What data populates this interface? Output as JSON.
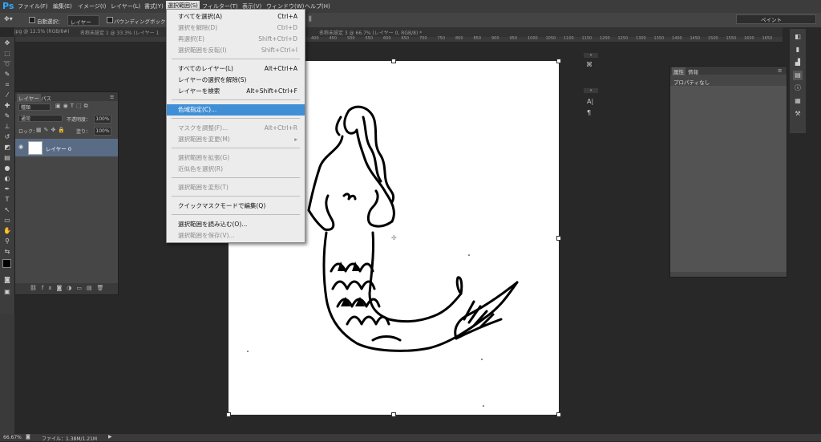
{
  "app": {
    "logo": "Ps"
  },
  "menubar": [
    {
      "label": "ファイル(F)"
    },
    {
      "label": "編集(E)"
    },
    {
      "label": "イメージ(I)"
    },
    {
      "label": "レイヤー(L)"
    },
    {
      "label": "書式(Y)"
    },
    {
      "label": "選択範囲(S)"
    },
    {
      "label": "フィルター(T)"
    },
    {
      "label": "表示(V)"
    },
    {
      "label": "ウィンドウ(W)"
    },
    {
      "label": "ヘルプ(H)"
    }
  ],
  "options": {
    "auto_select_label": "自動選択：",
    "auto_select_value": "レイヤー",
    "bbox_label": "バウンディングボックスを表",
    "workspace": "ペイント"
  },
  "tabs": [
    {
      "label": "jpg @ 12.5% (RGB/8#)"
    },
    {
      "label": "名称未設定 1 @ 33.3% (レイヤー 1"
    },
    {
      "label": "名称未設定 3 @ 66.7% (レイヤー 0, RGB/8) *"
    }
  ],
  "ruler_ticks": [
    "200",
    "250",
    "300",
    "350",
    "400",
    "450",
    "500",
    "550",
    "600",
    "650",
    "700",
    "750",
    "800",
    "850",
    "900",
    "950",
    "1000",
    "1050",
    "1100",
    "1150",
    "1200",
    "1250",
    "1300",
    "1350",
    "1400",
    "1450",
    "1500",
    "1550",
    "1600",
    "1650"
  ],
  "layers_panel": {
    "tab_layers": "レイヤー",
    "tab_paths": "パス",
    "kind_filter": "種類",
    "blend_mode": "通常",
    "opacity_label": "不透明度：",
    "opacity_value": "100%",
    "lock_label": "ロック：",
    "fill_label": "塗り：",
    "fill_value": "100%",
    "layer_name": "レイヤー 0"
  },
  "props_panel": {
    "tab_props": "属性",
    "tab_info": "情報",
    "body_text": "プロパティなし"
  },
  "statusbar": {
    "zoom": "66.67%",
    "file_info": "ファイル：1.38M/1.21M"
  },
  "dropdown": {
    "items": [
      {
        "label": "すべてを選択(A)",
        "shortcut": "Ctrl+A",
        "state": "enabled"
      },
      {
        "label": "選択を解除(D)",
        "shortcut": "Ctrl+D",
        "state": "disabled"
      },
      {
        "label": "再選択(E)",
        "shortcut": "Shift+Ctrl+D",
        "state": "disabled"
      },
      {
        "label": "選択範囲を反転(I)",
        "shortcut": "Shift+Ctrl+I",
        "state": "disabled"
      },
      {
        "label": "すべてのレイヤー(L)",
        "shortcut": "Alt+Ctrl+A",
        "state": "enabled"
      },
      {
        "label": "レイヤーの選択を解除(S)",
        "shortcut": "",
        "state": "enabled"
      },
      {
        "label": "レイヤーを検索",
        "shortcut": "Alt+Shift+Ctrl+F",
        "state": "enabled"
      },
      {
        "label": "色域指定(C)...",
        "shortcut": "",
        "state": "highlight"
      },
      {
        "label": "マスクを調整(F)...",
        "shortcut": "Alt+Ctrl+R",
        "state": "disabled"
      },
      {
        "label": "選択範囲を変更(M)",
        "shortcut": "▸",
        "state": "disabled"
      },
      {
        "label": "選択範囲を拡張(G)",
        "shortcut": "",
        "state": "disabled"
      },
      {
        "label": "近似色を選択(R)",
        "shortcut": "",
        "state": "disabled"
      },
      {
        "label": "選択範囲を変形(T)",
        "shortcut": "",
        "state": "disabled"
      },
      {
        "label": "クイックマスクモードで編集(Q)",
        "shortcut": "",
        "state": "enabled"
      },
      {
        "label": "選択範囲を読み込む(O)...",
        "shortcut": "",
        "state": "enabled"
      },
      {
        "label": "選択範囲を保存(V)...",
        "shortcut": "",
        "state": "disabled"
      }
    ]
  },
  "colors": {
    "accent": "#3f8fd6",
    "bg": "#282828",
    "panel": "#464646",
    "logo": "#31a8ff"
  }
}
